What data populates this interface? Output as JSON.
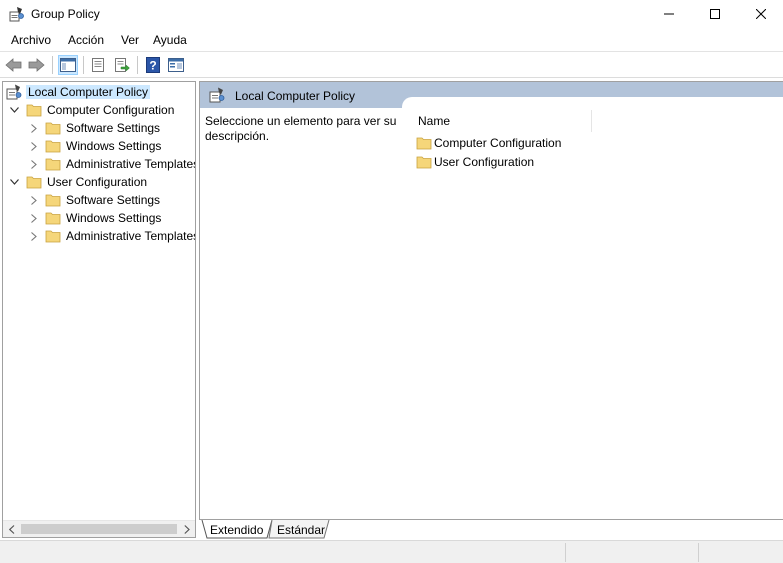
{
  "window": {
    "title": "Group Policy",
    "icons": {
      "app": "group-policy-icon",
      "minimize": "minimize-icon",
      "maximize": "maximize-icon",
      "close": "close-icon"
    }
  },
  "menu": {
    "items": [
      {
        "label": "Archivo"
      },
      {
        "label": "Acción"
      },
      {
        "label": "Ver"
      },
      {
        "label": "Ayuda"
      }
    ]
  },
  "toolbar": {
    "icons": [
      "back-arrow-icon",
      "forward-arrow-icon",
      "show-hide-tree-icon",
      "properties-icon",
      "export-list-icon",
      "help-icon",
      "view-icon"
    ]
  },
  "tree": {
    "root": {
      "label": "Local Computer Policy",
      "icon": "policy-icon"
    },
    "nodes": [
      {
        "label": "Computer Configuration",
        "children": [
          {
            "label": "Software Settings"
          },
          {
            "label": "Windows Settings"
          },
          {
            "label": "Administrative Templates"
          }
        ]
      },
      {
        "label": "User Configuration",
        "children": [
          {
            "label": "Software Settings"
          },
          {
            "label": "Windows Settings"
          },
          {
            "label": "Administrative Templates"
          }
        ]
      }
    ]
  },
  "details": {
    "header": "Local Computer Policy",
    "description": "Seleccione un elemento para ver su descripción.",
    "column_name": "Name",
    "items": [
      {
        "label": "Computer Configuration"
      },
      {
        "label": "User Configuration"
      }
    ]
  },
  "tabs": [
    {
      "label": "Extendido"
    },
    {
      "label": "Estándar"
    }
  ],
  "colors": {
    "header_band": "#b2c3d9",
    "selection": "#cce8ff",
    "folder": "#f5d67a"
  }
}
